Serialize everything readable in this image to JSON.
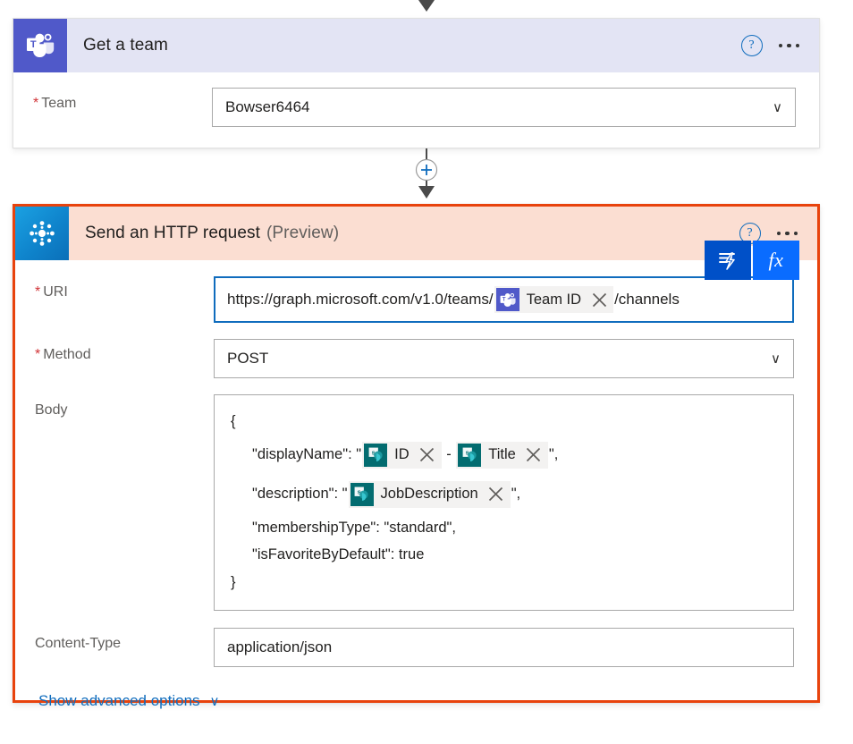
{
  "colors": {
    "teams_purple": "#5059c9",
    "teams_header_bg": "#e3e4f4",
    "http_header_bg": "#fbded2",
    "selected_border": "#e8430d",
    "link_blue": "#0f6cbd",
    "dynamic_btn_blue": "#0050c8",
    "fx_btn_blue": "#0a6cff",
    "sharepoint_teal": "#036c70",
    "required_red": "#d13438"
  },
  "steps": [
    {
      "id": "get-a-team",
      "title": "Get a team",
      "icon": "microsoft-teams-icon",
      "help_icon": "help-circle-icon",
      "more_icon": "more-options-icon",
      "fields": [
        {
          "label": "Team",
          "required": true,
          "control": "dropdown",
          "value": "Bowser6464",
          "chevron": "∨"
        }
      ]
    },
    {
      "id": "send-an-http-request",
      "title": "Send an HTTP request",
      "preview_tag": "(Preview)",
      "icon": "office365-groups-icon",
      "help_icon": "help-circle-icon",
      "more_icon": "more-options-icon",
      "toolbar": {
        "dynamic_content_icon": "dynamic-content-icon",
        "expression_label": "fx"
      },
      "fields": [
        {
          "label": "URI",
          "required": true,
          "control": "textbox-focused",
          "segments": [
            {
              "kind": "text",
              "text": "https://graph.microsoft.com/v1.0/teams/"
            },
            {
              "kind": "token",
              "name": "Team ID",
              "source": "teams",
              "remove_icon": "remove-token-icon"
            },
            {
              "kind": "text",
              "text": "/channels"
            }
          ]
        },
        {
          "label": "Method",
          "required": true,
          "control": "dropdown",
          "value": "POST",
          "chevron": "∨"
        },
        {
          "label": "Body",
          "required": false,
          "control": "multiline",
          "lines": [
            {
              "indent": 0,
              "segments": [
                {
                  "kind": "text",
                  "text": "{"
                }
              ]
            },
            {
              "indent": 1,
              "segments": [
                {
                  "kind": "text",
                  "text": "\"displayName\": \""
                },
                {
                  "kind": "token",
                  "name": "ID",
                  "source": "sharepoint",
                  "remove_icon": "remove-token-icon"
                },
                {
                  "kind": "text",
                  "text": " - "
                },
                {
                  "kind": "token",
                  "name": "Title",
                  "source": "sharepoint",
                  "remove_icon": "remove-token-icon"
                },
                {
                  "kind": "text",
                  "text": "\","
                }
              ]
            },
            {
              "indent": 1,
              "segments": [
                {
                  "kind": "text",
                  "text": "\"description\": \""
                },
                {
                  "kind": "token",
                  "name": "JobDescription",
                  "source": "sharepoint",
                  "remove_icon": "remove-token-icon"
                },
                {
                  "kind": "text",
                  "text": "\","
                }
              ]
            },
            {
              "indent": 1,
              "segments": [
                {
                  "kind": "text",
                  "text": "\"membershipType\": \"standard\","
                }
              ]
            },
            {
              "indent": 1,
              "segments": [
                {
                  "kind": "text",
                  "text": "\"isFavoriteByDefault\": true"
                }
              ]
            },
            {
              "indent": 0,
              "segments": [
                {
                  "kind": "text",
                  "text": "}"
                }
              ]
            }
          ]
        },
        {
          "label": "Content-Type",
          "required": false,
          "control": "textbox",
          "value": "application/json"
        }
      ],
      "advanced_options": {
        "label": "Show advanced options",
        "chevron": "∨",
        "icon": "chevron-down-icon"
      }
    }
  ],
  "connectors": [
    {
      "id": "top-arrow",
      "icon": "arrow-down-icon",
      "has_insert": false
    },
    {
      "id": "insert-between",
      "icon": "add-step-icon",
      "has_insert": true,
      "plus": "+"
    }
  ]
}
